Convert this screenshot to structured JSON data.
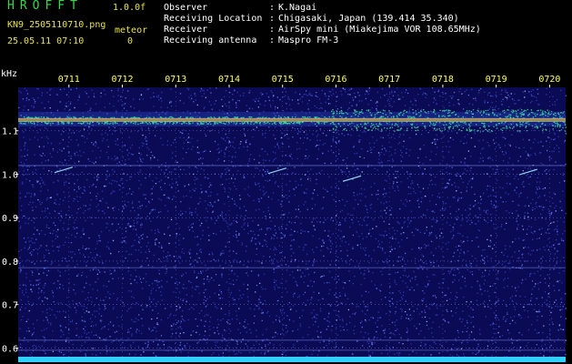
{
  "header": {
    "app_title": "HROFFT",
    "app_version": "1.0.0f",
    "file_name": "KN9_2505110710.png",
    "date_time": "25.05.11 07:10",
    "meteor_label": "meteor",
    "meteor_count": "0",
    "meta": [
      {
        "key": "Observer",
        "value": "K.Nagai"
      },
      {
        "key": "Receiving Location",
        "value": "Chigasaki, Japan (139.414 35.340)"
      },
      {
        "key": "Receiver",
        "value": "AirSpy mini (Miakejima VOR 108.65MHz)"
      },
      {
        "key": "Receiving antenna",
        "value": "Maspro FM-3"
      }
    ]
  },
  "chart_data": {
    "type": "heatmap",
    "ylabel": "kHz",
    "ylim": [
      0.58,
      1.2
    ],
    "yticks": [
      "1.1",
      "1.0",
      "0.9",
      "0.8",
      "0.7",
      "0.6"
    ],
    "ytick_values": [
      1.1,
      1.0,
      0.9,
      0.8,
      0.7,
      0.6
    ],
    "xticks": [
      "0711",
      "0712",
      "0713",
      "0714",
      "0715",
      "0716",
      "0717",
      "0718",
      "0719",
      "0720"
    ],
    "xtick_minutes": [
      11,
      12,
      13,
      14,
      15,
      16,
      17,
      18,
      19,
      20
    ],
    "xlim_minutes": [
      10.05,
      20.3
    ],
    "carrier_khz": 1.125,
    "horizontal_lines_khz": [
      1.02,
      0.785,
      0.618,
      0.595
    ],
    "meteor_echoes": [
      {
        "minute": 10.9,
        "khz": 1.01
      },
      {
        "minute": 14.9,
        "khz": 1.008
      },
      {
        "minute": 16.3,
        "khz": 0.99
      },
      {
        "minute": 19.6,
        "khz": 1.005
      }
    ],
    "colors": {
      "background": "#0a0a55",
      "noise": "#3a48c8",
      "carrier": "#ff5a3a",
      "carrier_glow": "#40e8a0",
      "grid": "#8a8ae0",
      "axis_text": "#ffffff",
      "tick_label": "#ffff60",
      "baseline": "#30d0ff"
    }
  }
}
